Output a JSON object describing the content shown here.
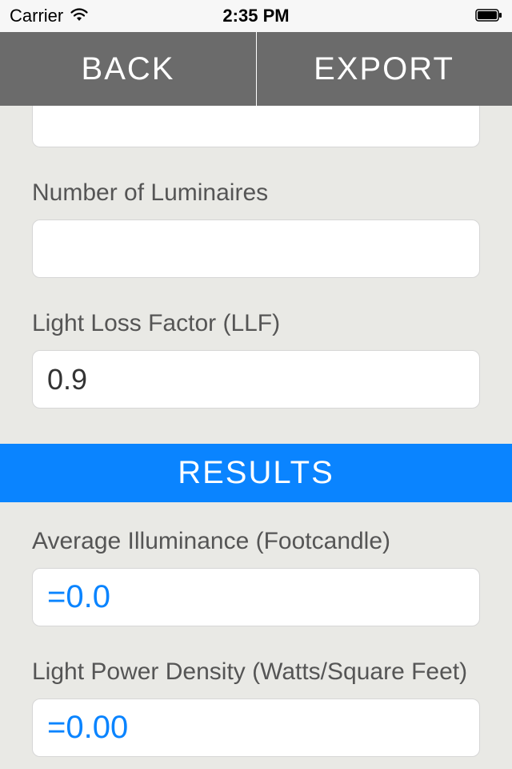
{
  "status": {
    "carrier": "Carrier",
    "time": "2:35 PM"
  },
  "nav": {
    "back": "BACK",
    "export": "EXPORT"
  },
  "fields": {
    "top_partial_value": "",
    "num_luminaires_label": "Number of Luminaires",
    "num_luminaires_value": "",
    "llf_label": "Light Loss Factor (LLF)",
    "llf_value": "0.9"
  },
  "results": {
    "banner": "RESULTS",
    "avg_illum_label": "Average Illuminance (Footcandle)",
    "avg_illum_value": "=0.0",
    "lpd_label": "Light Power Density (Watts/Square Feet)",
    "lpd_value": "=0.00"
  }
}
